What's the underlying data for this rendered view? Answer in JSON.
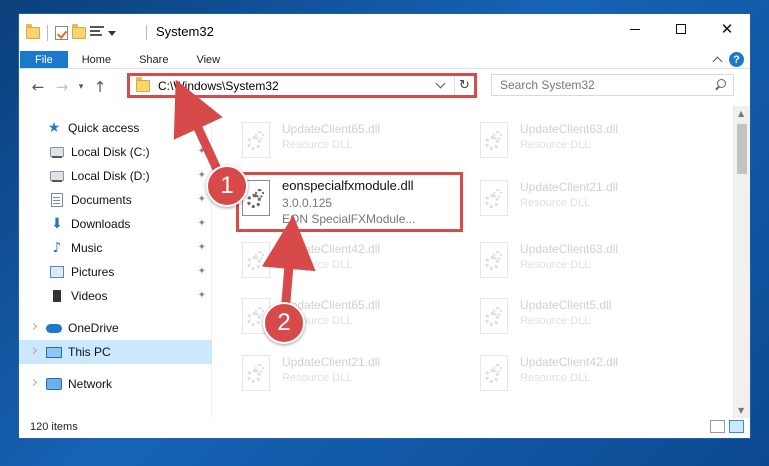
{
  "title_bar": {
    "title": "System32"
  },
  "ribbon": {
    "tabs": [
      "File",
      "Home",
      "Share",
      "View"
    ]
  },
  "address": {
    "path": "C:\\Windows\\System32"
  },
  "search": {
    "placeholder": "Search System32"
  },
  "sidebar": {
    "items": [
      {
        "label": "Quick access",
        "icon": "star-icon",
        "pinned": false
      },
      {
        "label": "Local Disk (C:)",
        "icon": "drive-icon",
        "pinned": true
      },
      {
        "label": "Local Disk (D:)",
        "icon": "drive-icon",
        "pinned": true
      },
      {
        "label": "Documents",
        "icon": "documents-icon",
        "pinned": true
      },
      {
        "label": "Downloads",
        "icon": "download-icon",
        "pinned": true
      },
      {
        "label": "Music",
        "icon": "music-icon",
        "pinned": true
      },
      {
        "label": "Pictures",
        "icon": "pictures-icon",
        "pinned": true
      },
      {
        "label": "Videos",
        "icon": "videos-icon",
        "pinned": true
      },
      {
        "label": "OneDrive",
        "icon": "onedrive-icon",
        "pinned": false
      },
      {
        "label": "This PC",
        "icon": "computer-icon",
        "pinned": false
      },
      {
        "label": "Network",
        "icon": "network-icon",
        "pinned": false
      }
    ]
  },
  "files": [
    {
      "name": "UpdateClient65.dll",
      "sub": "Resource DLL"
    },
    {
      "name": "UpdateClient63.dll",
      "sub": "Resource DLL"
    },
    {
      "name": "eonspecialfxmodule.dll",
      "version": "3.0.0.125",
      "description": "EON SpecialFXModule..."
    },
    {
      "name": "UpdateClient21.dll",
      "sub": "Resource DLL"
    },
    {
      "name": "UpdateClient42.dll",
      "sub": "Resource DLL"
    },
    {
      "name": "UpdateClient63.dll",
      "sub": "Resource DLL"
    },
    {
      "name": "UpdateClient65.dll",
      "sub": "Resource DLL"
    },
    {
      "name": "UpdateClient5.dll",
      "sub": "Resource DLL"
    },
    {
      "name": "UpdateClient21.dll",
      "sub": "Resource DLL"
    },
    {
      "name": "UpdateClient42.dll",
      "sub": "Resource DLL"
    }
  ],
  "status": {
    "count": "120 items"
  },
  "callouts": [
    "1",
    "2"
  ],
  "colors": {
    "accent": "#1979ca",
    "highlight": "#d94b4b",
    "selected_bg": "#cce8ff"
  }
}
